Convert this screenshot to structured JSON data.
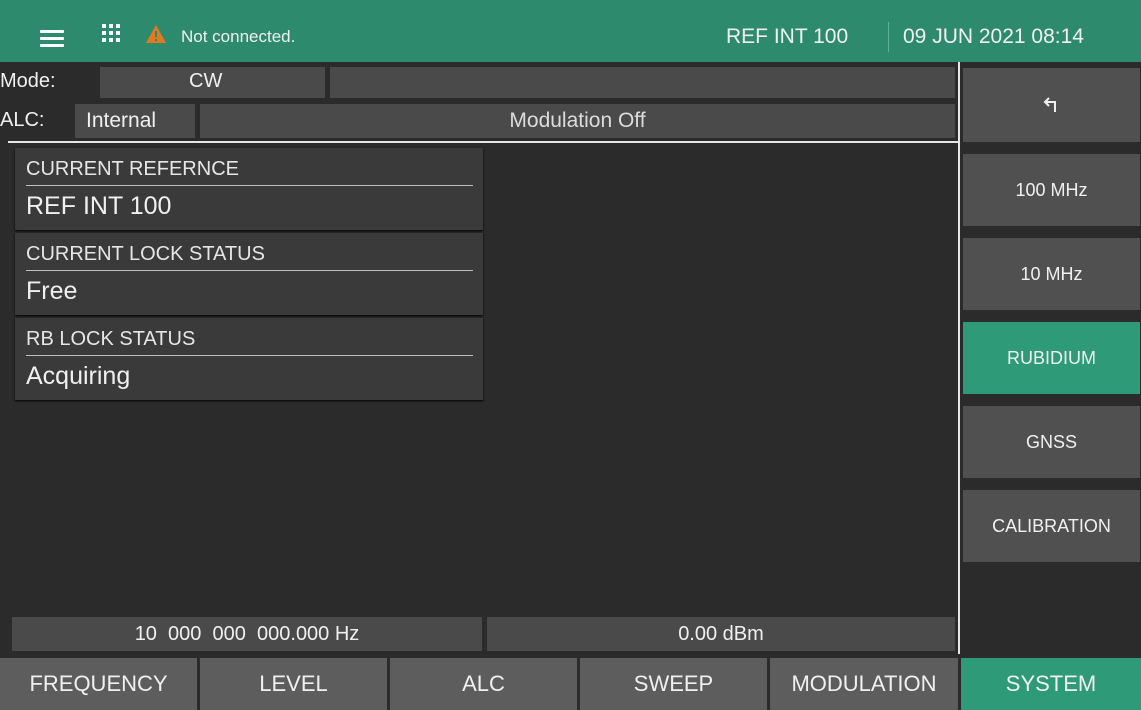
{
  "topbar": {
    "status_text": "Not connected.",
    "reference": "REF INT 100",
    "datetime": "09 JUN 2021 08:14",
    "accent_color": "#2e8a6c",
    "warning_color": "#e07a20",
    "icons": [
      "menu-icon",
      "apps-grid-icon",
      "warning-icon"
    ]
  },
  "status": {
    "mode_label": "Mode:",
    "mode_value": "CW",
    "alc_label": "ALC:",
    "alc_value": "Internal",
    "modulation": "Modulation Off"
  },
  "cards": [
    {
      "title": "CURRENT REFERNCE",
      "value": "REF INT 100"
    },
    {
      "title": "CURRENT LOCK STATUS",
      "value": "Free"
    },
    {
      "title": "RB LOCK STATUS",
      "value": "Acquiring"
    }
  ],
  "readouts": {
    "frequency": "10  000  000  000.000 Hz",
    "level": "0.00 dBm"
  },
  "softkeys": {
    "back_icon": "back-arrow-icon",
    "items": [
      "100 MHz",
      "10 MHz",
      "RUBIDIUM",
      "GNSS",
      "CALIBRATION"
    ],
    "active": "RUBIDIUM"
  },
  "tabs": {
    "items": [
      "FREQUENCY",
      "LEVEL",
      "ALC",
      "SWEEP",
      "MODULATION",
      "SYSTEM"
    ],
    "active": "SYSTEM"
  }
}
